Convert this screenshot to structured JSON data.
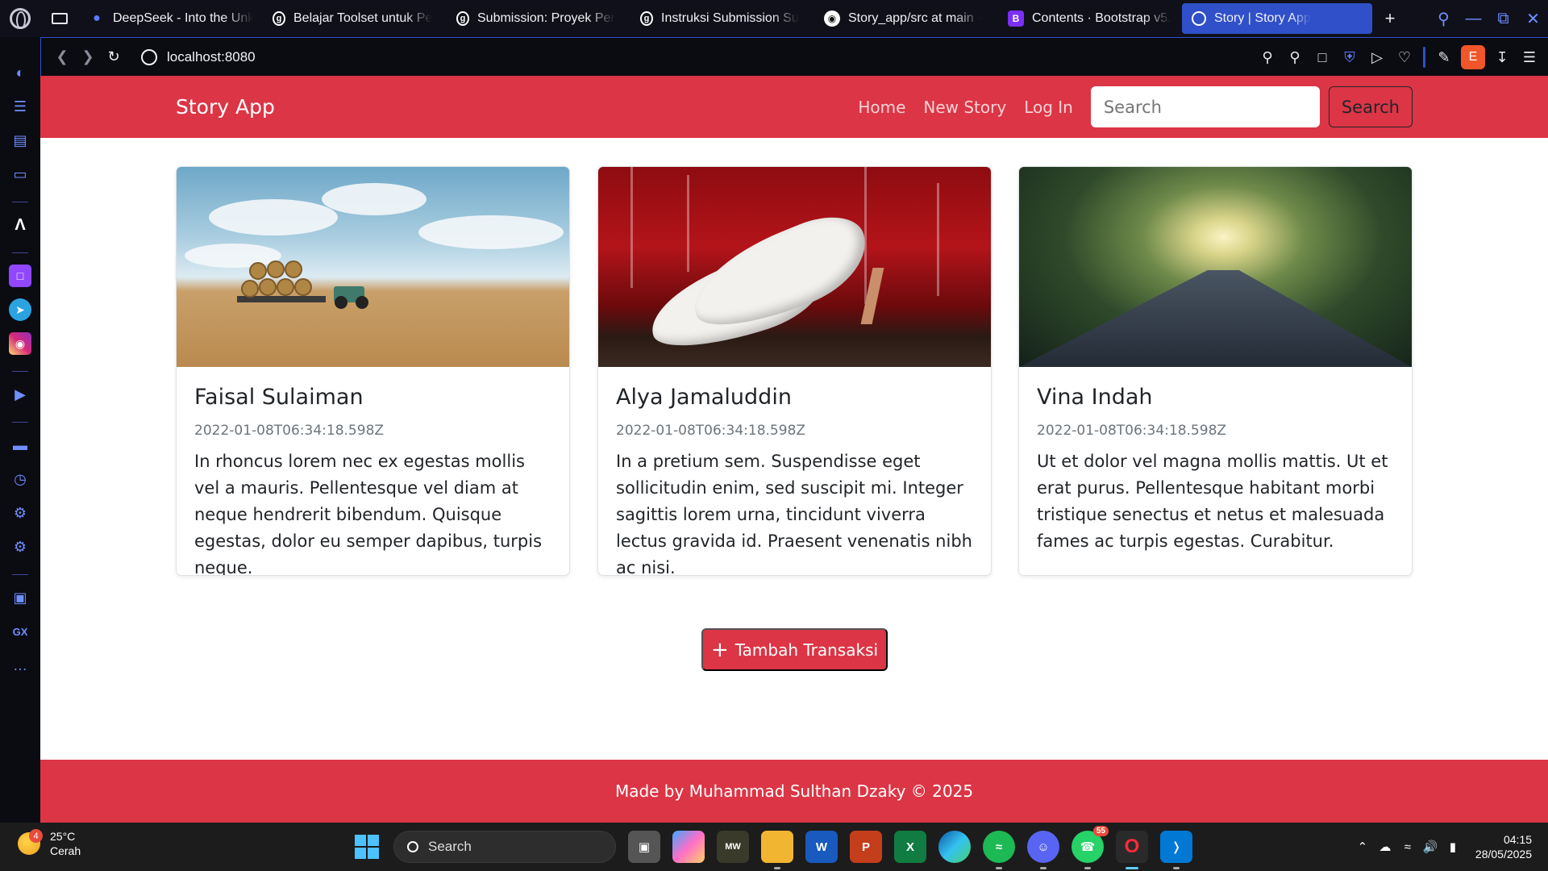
{
  "browser": {
    "tabs": [
      {
        "title": "DeepSeek - Into the Unk",
        "icon": "deepseek-icon",
        "active": false
      },
      {
        "title": "Belajar Toolset untuk Pe",
        "icon": "dicoding-icon",
        "active": false
      },
      {
        "title": "Submission: Proyek Per",
        "icon": "dicoding-icon",
        "active": false
      },
      {
        "title": "Instruksi Submission Su",
        "icon": "dicoding-icon",
        "active": false
      },
      {
        "title": "Story_app/src at main ·",
        "icon": "github-icon",
        "active": false
      },
      {
        "title": "Contents · Bootstrap v5.",
        "icon": "bootstrap-icon",
        "active": false
      },
      {
        "title": "Story | Story App",
        "icon": "globe-icon",
        "active": true
      }
    ],
    "address": "localhost:8080",
    "profile_initial": "E",
    "accent_color": "#2f50c9"
  },
  "site": {
    "brand": "Story App",
    "nav": {
      "home": "Home",
      "new_story": "New Story",
      "login": "Log In"
    },
    "search": {
      "placeholder": "Search",
      "button": "Search"
    },
    "cards": [
      {
        "title": "Faisal Sulaiman",
        "date": "2022-01-08T06:34:18.598Z",
        "text": "In rhoncus lorem nec ex egestas mollis vel a mauris. Pellentesque vel diam at neque hendrerit bibendum. Quisque egestas, dolor eu semper dapibus, turpis neque."
      },
      {
        "title": "Alya Jamaluddin",
        "date": "2022-01-08T06:34:18.598Z",
        "text": "In a pretium sem. Suspendisse eget sollicitudin enim, sed suscipit mi. Integer sagittis lorem urna, tincidunt viverra lectus gravida id. Praesent venenatis nibh ac nisi."
      },
      {
        "title": "Vina Indah",
        "date": "2022-01-08T06:34:18.598Z",
        "text": "Ut et dolor vel magna mollis mattis. Ut et erat purus. Pellentesque habitant morbi tristique senectus et netus et malesuada fames ac turpis egestas. Curabitur."
      }
    ],
    "add_button": "Tambah Transaksi",
    "footer": "Made by Muhammad Sulthan Dzaky © 2025",
    "primary_color": "#dc3545"
  },
  "taskbar": {
    "weather": {
      "temp": "25°C",
      "condition": "Cerah",
      "badge": "4"
    },
    "search_label": "Search",
    "whatsapp_count": "55",
    "time": "04:15",
    "date": "28/05/2025"
  }
}
